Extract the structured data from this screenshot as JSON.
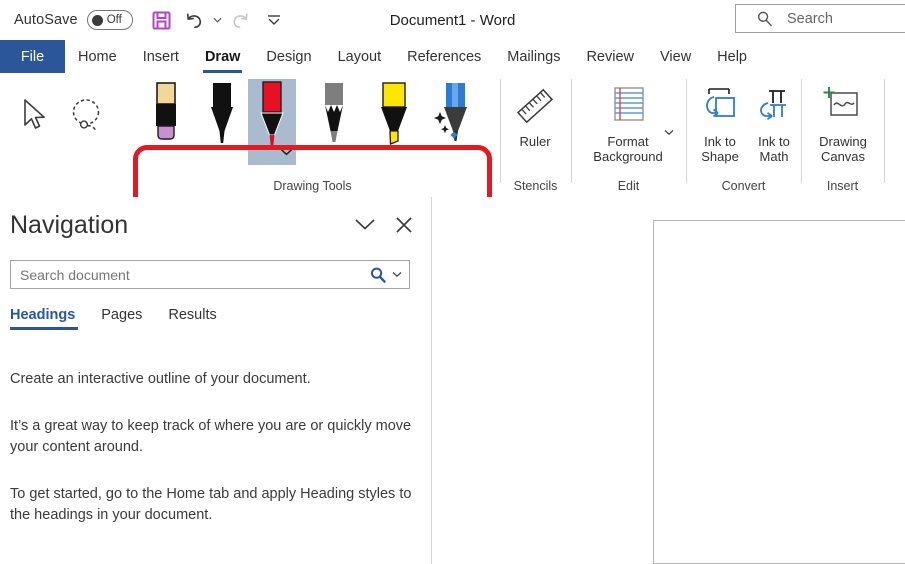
{
  "titlebar": {
    "autosave_label": "AutoSave",
    "autosave_state": "Off",
    "document_title": "Document1  -  Word",
    "save_icon": "save-icon",
    "undo_icon": "undo-icon",
    "redo_icon": "redo-icon",
    "customize_icon": "customize-quick-access-toolbar-icon",
    "save_color": "#b146c2"
  },
  "search": {
    "placeholder": "Search",
    "icon": "search-icon"
  },
  "tabs": [
    {
      "label": "File",
      "active": false,
      "is_file": true
    },
    {
      "label": "Home",
      "active": false
    },
    {
      "label": "Insert",
      "active": false
    },
    {
      "label": "Draw",
      "active": true
    },
    {
      "label": "Design",
      "active": false
    },
    {
      "label": "Layout",
      "active": false
    },
    {
      "label": "References",
      "active": false
    },
    {
      "label": "Mailings",
      "active": false
    },
    {
      "label": "Review",
      "active": false
    },
    {
      "label": "View",
      "active": false
    },
    {
      "label": "Help",
      "active": false
    }
  ],
  "ribbon": {
    "accent_color": "#2b579a",
    "annotation_color": "#e01b22",
    "selection_color": "#aabbd0",
    "groups": [
      {
        "label": ""
      },
      {
        "label": "Drawing Tools"
      },
      {
        "label": "Stencils"
      },
      {
        "label": "Edit"
      },
      {
        "label": "Convert"
      },
      {
        "label": "Insert"
      }
    ],
    "select_tools": [
      {
        "name": "select-object-tool",
        "icon": "cursor-arrow-icon"
      },
      {
        "name": "lasso-select-tool",
        "icon": "lasso-select-icon"
      }
    ],
    "drawing_tools": [
      {
        "name": "eraser",
        "icon": "eraser-icon",
        "selected": false,
        "color": "#c98fd0"
      },
      {
        "name": "black-pen",
        "icon": "pen-icon",
        "selected": false,
        "color": "#000000"
      },
      {
        "name": "red-pen",
        "icon": "pen-icon",
        "selected": true,
        "color": "#e81123",
        "has_dropdown": true
      },
      {
        "name": "gray-pencil",
        "icon": "pencil-icon",
        "selected": false,
        "color": "#7a7a7a"
      },
      {
        "name": "yellow-highlighter",
        "icon": "highlighter-icon",
        "selected": false,
        "color": "#ffe600"
      },
      {
        "name": "blue-action-pen",
        "icon": "action-pen-icon",
        "selected": false,
        "color": "#2b7cd3"
      }
    ],
    "commands": [
      {
        "name": "ruler",
        "label": "Ruler",
        "icon": "ruler-icon",
        "group": "Stencils"
      },
      {
        "name": "format-background",
        "label": "Format\nBackground",
        "icon": "format-background-icon",
        "group": "Edit",
        "has_dropdown": true
      },
      {
        "name": "ink-to-shape",
        "label": "Ink to\nShape",
        "icon": "ink-to-shape-icon",
        "group": "Convert"
      },
      {
        "name": "ink-to-math",
        "label": "Ink to\nMath",
        "icon": "ink-to-math-icon",
        "group": "Convert"
      },
      {
        "name": "drawing-canvas",
        "label": "Drawing\nCanvas",
        "icon": "drawing-canvas-icon",
        "group": "Insert"
      }
    ]
  },
  "navigation": {
    "title": "Navigation",
    "collapse_icon": "chevron-down-icon",
    "close_icon": "close-icon",
    "search_placeholder": "Search document",
    "search_icon": "magnifier-icon",
    "search_dropdown_icon": "chevron-down-icon",
    "tabs": [
      {
        "label": "Headings",
        "active": true
      },
      {
        "label": "Pages",
        "active": false
      },
      {
        "label": "Results",
        "active": false
      }
    ],
    "paragraphs": [
      "Create an interactive outline of your document.",
      "It’s a great way to keep track of where you are or quickly move your content around.",
      "To get started, go to the Home tab and apply Heading styles to the headings in your document."
    ]
  },
  "document": {
    "page_background": "#ffffff",
    "page_border": "#b4b4b4"
  }
}
